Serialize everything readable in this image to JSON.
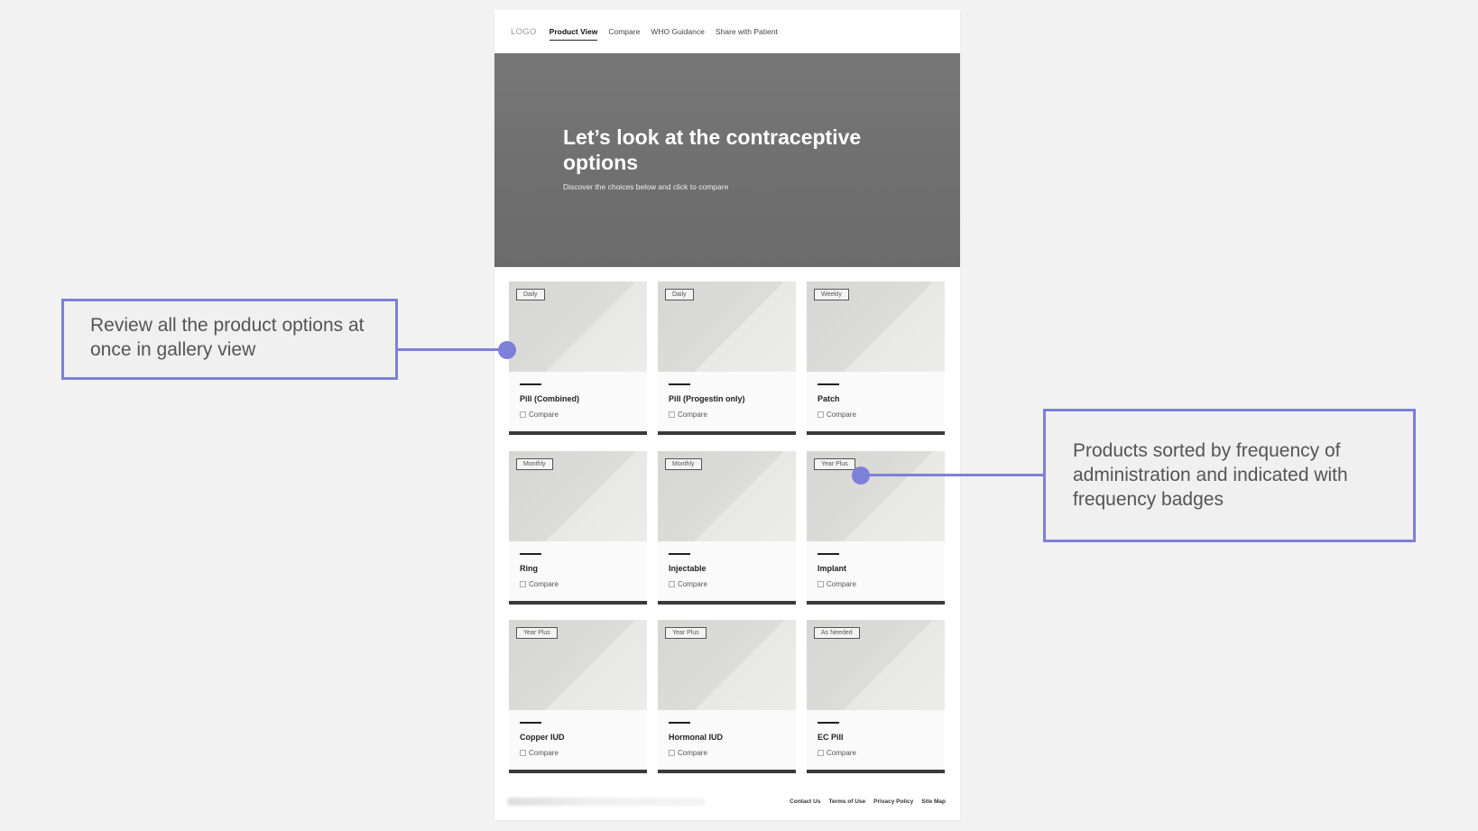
{
  "nav": {
    "logo": "LOGO",
    "links": [
      "Product View",
      "Compare",
      "WHO Guidance",
      "Share with Patient"
    ],
    "active": "Product View"
  },
  "hero": {
    "title": "Let’s look at the contraceptive options",
    "subtitle": "Discover the choices below and click to compare"
  },
  "products": [
    {
      "badge": "Daily",
      "name": "Pill (Combined)",
      "compare_label": "Compare"
    },
    {
      "badge": "Daily",
      "name": "Pill (Progestin only)",
      "compare_label": "Compare"
    },
    {
      "badge": "Weekly",
      "name": "Patch",
      "compare_label": "Compare"
    },
    {
      "badge": "Monthly",
      "name": "Ring",
      "compare_label": "Compare"
    },
    {
      "badge": "Monthly",
      "name": "Injectable",
      "compare_label": "Compare"
    },
    {
      "badge": "Year Plus",
      "name": "Implant",
      "compare_label": "Compare"
    },
    {
      "badge": "Year Plus",
      "name": "Copper IUD",
      "compare_label": "Compare"
    },
    {
      "badge": "Year Plus",
      "name": "Hormonal IUD",
      "compare_label": "Compare"
    },
    {
      "badge": "As Needed",
      "name": "EC Pill",
      "compare_label": "Compare"
    }
  ],
  "footer": {
    "links": [
      "Contact Us",
      "Terms of Use",
      "Privacy Policy",
      "Site Map"
    ]
  },
  "annotations": {
    "left": "Review all the product options at once in gallery view",
    "right": "Products sorted by frequency of administration and indicated with frequency badges",
    "accent_color": "#7d80d8"
  }
}
